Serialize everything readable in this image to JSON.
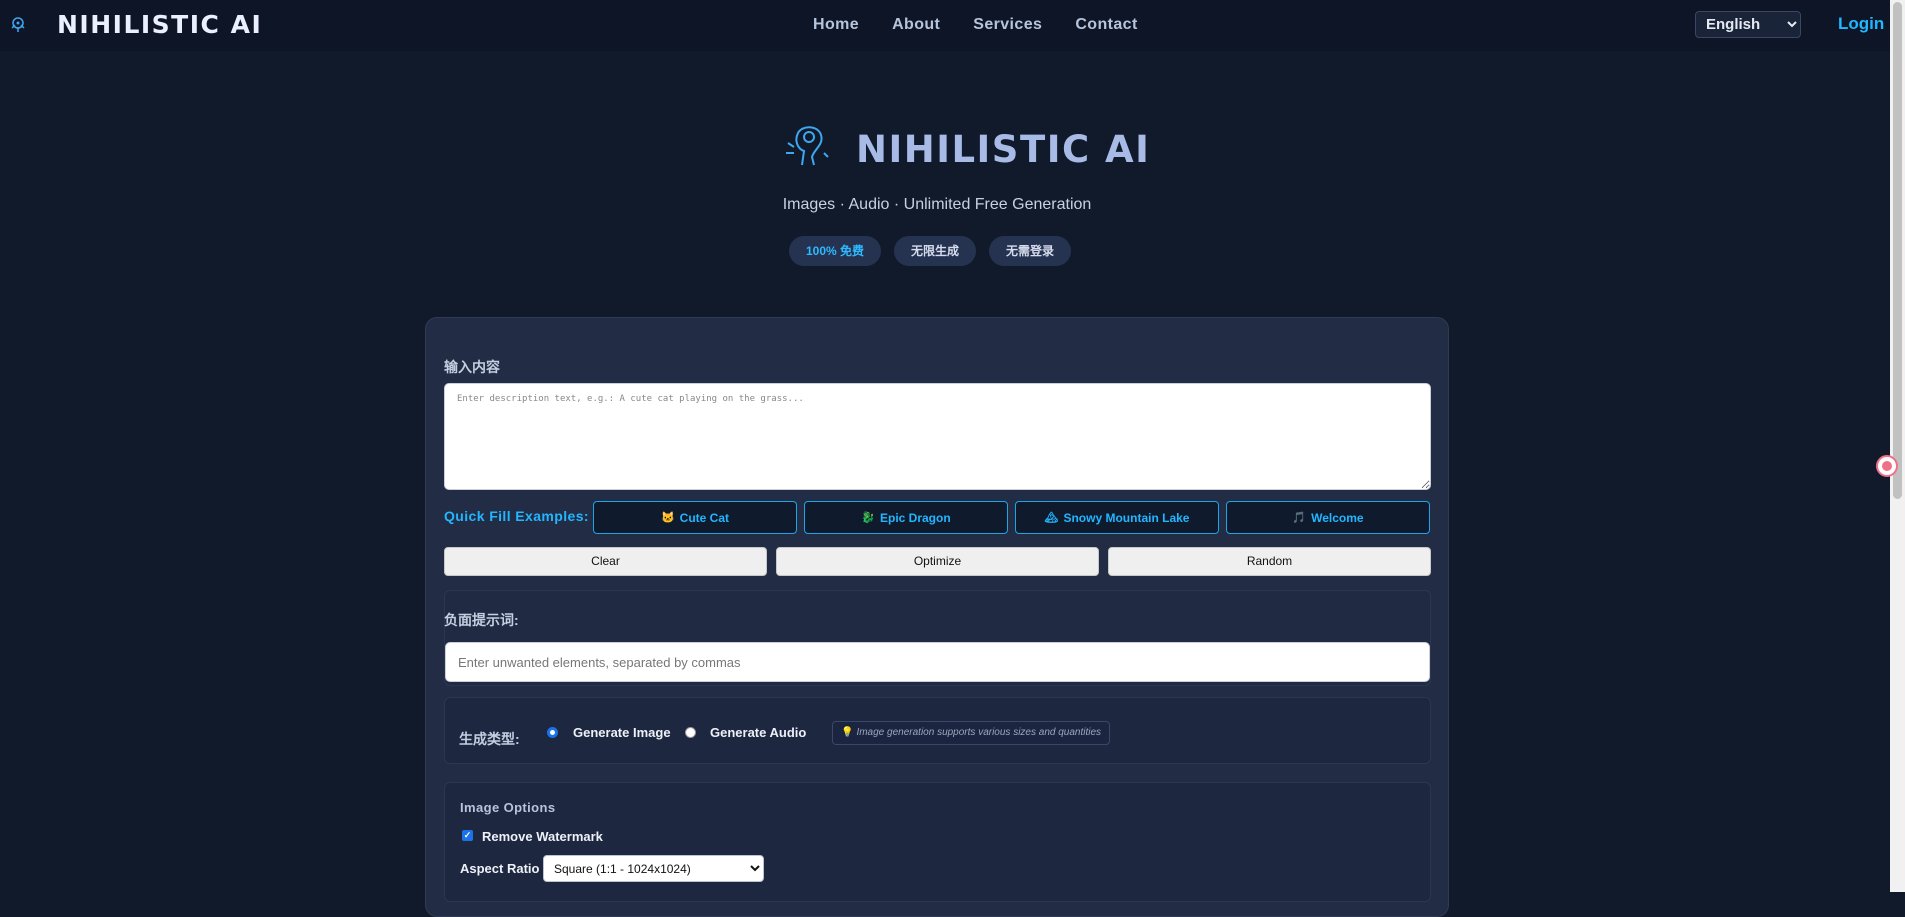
{
  "nav": {
    "brand": "NIHILISTIC AI",
    "links": [
      "Home",
      "About",
      "Services",
      "Contact"
    ],
    "language": "English",
    "login": "Login"
  },
  "hero": {
    "title": "NIHILISTIC AI",
    "subtitle": "Images · Audio · Unlimited Free Generation",
    "pills": [
      "100% 免费",
      "无限生成",
      "无需登录"
    ]
  },
  "form": {
    "input_label": "输入内容",
    "prompt_placeholder": "Enter description text, e.g.: A cute cat playing on the grass...",
    "quick_fill_label": "Quick Fill Examples:",
    "quick_fill": [
      {
        "icon": "🐱",
        "label": "Cute Cat"
      },
      {
        "icon": "🐉",
        "label": "Epic Dragon"
      },
      {
        "icon": "🏔",
        "label": "Snowy Mountain Lake"
      },
      {
        "icon": "🎵",
        "label": "Welcome"
      }
    ],
    "actions": [
      "Clear",
      "Optimize",
      "Random"
    ],
    "negative_label": "负面提示词:",
    "negative_placeholder": "Enter unwanted elements, separated by commas",
    "type_label": "生成类型:",
    "type_options": [
      "Generate Image",
      "Generate Audio"
    ],
    "type_selected": "Generate Image",
    "hint_icon": "💡",
    "hint": "Image generation supports various sizes and quantities"
  },
  "image_options": {
    "title": "Image Options",
    "remove_watermark_label": "Remove Watermark",
    "remove_watermark": true,
    "aspect_ratio_label": "Aspect Ratio",
    "aspect_ratio_value": "Square (1:1 - 1024x1024)"
  },
  "colors": {
    "background": "#111a2b",
    "accent": "#22b6ff",
    "card": "#222c45"
  }
}
